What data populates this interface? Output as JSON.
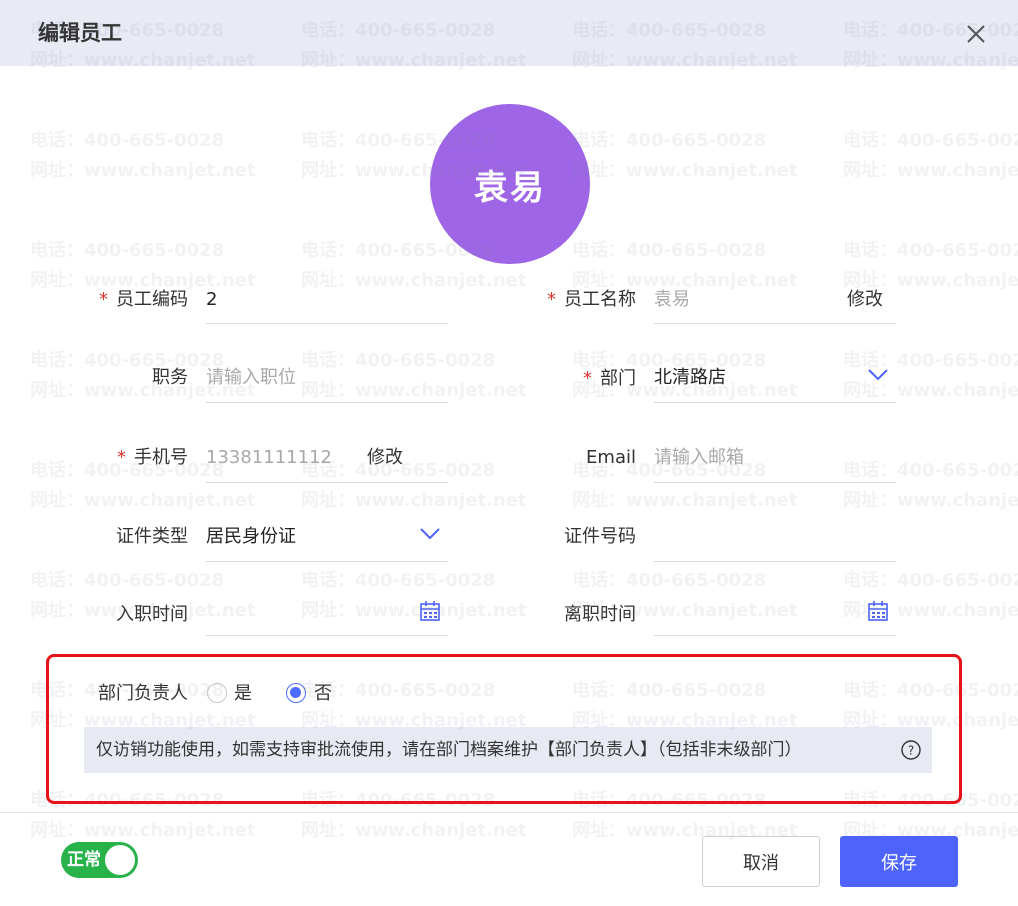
{
  "dialog": {
    "title": "编辑员工",
    "close_icon": "close-icon"
  },
  "watermark": {
    "phone": "电话：400-665-0028",
    "site": "网址：www.chanjet.net"
  },
  "avatar": {
    "text": "袁易",
    "color": "#9e66e6"
  },
  "form": {
    "required_mark": "*",
    "employee_code": {
      "label": "员工编码",
      "value": "2"
    },
    "employee_name": {
      "label": "员工名称",
      "value": "袁易",
      "action": "修改"
    },
    "position": {
      "label": "职务",
      "placeholder": "请输入职位"
    },
    "department": {
      "label": "部门",
      "value": "北清路店",
      "icon": "chevron-down-icon"
    },
    "mobile": {
      "label": "手机号",
      "value": "13381111112",
      "action": "修改"
    },
    "email": {
      "label": "Email",
      "placeholder": "请输入邮箱"
    },
    "id_type": {
      "label": "证件类型",
      "value": "居民身份证",
      "icon": "chevron-down-icon"
    },
    "id_number": {
      "label": "证件号码",
      "value": ""
    },
    "hire_date": {
      "label": "入职时间",
      "icon": "calendar-icon"
    },
    "leave_date": {
      "label": "离职时间",
      "icon": "calendar-icon"
    },
    "dept_head": {
      "label": "部门负责人",
      "options": [
        "是",
        "否"
      ],
      "selected": "否"
    },
    "notice": "仅访销功能使用，如需支持审批流使用，请在部门档案维护【部门负责人】（包括非末级部门）",
    "notice_icon": "help-circle-icon"
  },
  "footer": {
    "status_label": "正常",
    "status_on": true,
    "cancel_label": "取消",
    "save_label": "保存"
  },
  "colors": {
    "primary": "#4d63fa",
    "required": "#e03131",
    "toggle_on": "#27b24a",
    "highlight": "#e8121b",
    "header_bg": "#e8ebf4"
  }
}
